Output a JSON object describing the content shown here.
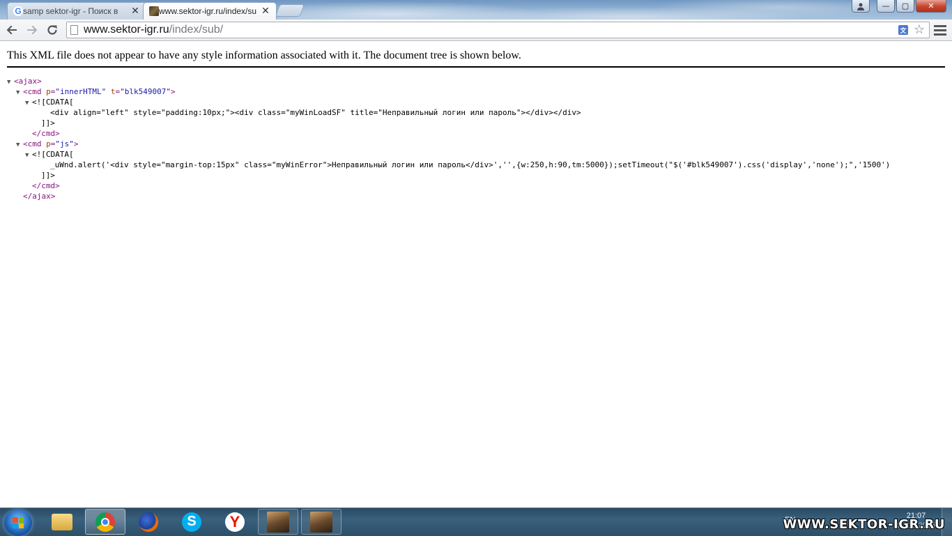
{
  "browser": {
    "tabs": [
      {
        "title": "samp sektor-igr - Поиск в",
        "active": false,
        "icon": "google-icon"
      },
      {
        "title": "www.sektor-igr.ru/index/su",
        "active": true,
        "icon": "site-favicon"
      }
    ],
    "tab_close_glyph": "✕",
    "window_buttons": {
      "minimize": "—",
      "maximize": "▢",
      "close": "✕"
    },
    "address": {
      "host": "www.sektor-igr.ru",
      "path": "/index/sub/"
    }
  },
  "page": {
    "xml_notice": "This XML file does not appear to have any style information associated with it. The document tree is shown below.",
    "tree_lines": [
      {
        "indent": 0,
        "tri": "▼",
        "segments": [
          {
            "t": "tag",
            "v": "<ajax>"
          }
        ]
      },
      {
        "indent": 1,
        "tri": "▼",
        "segments": [
          {
            "t": "tag",
            "v": "<cmd "
          },
          {
            "t": "attr",
            "v": "p"
          },
          {
            "t": "tag",
            "v": "="
          },
          {
            "t": "val",
            "v": "\"innerHTML\""
          },
          {
            "t": "tag",
            "v": " "
          },
          {
            "t": "attr",
            "v": "t"
          },
          {
            "t": "tag",
            "v": "="
          },
          {
            "t": "val",
            "v": "\"blk549007\""
          },
          {
            "t": "tag",
            "v": ">"
          }
        ]
      },
      {
        "indent": 2,
        "tri": "▼",
        "segments": [
          {
            "t": "plain",
            "v": "<![CDATA["
          }
        ]
      },
      {
        "indent": 4,
        "tri": "",
        "segments": [
          {
            "t": "plain",
            "v": "<div align=\"left\" style=\"padding:10px;\"><div class=\"myWinLoadSF\" title=\"Неправильный логин или пароль\"></div></div>"
          }
        ]
      },
      {
        "indent": 3,
        "tri": "",
        "segments": [
          {
            "t": "plain",
            "v": "]]>"
          }
        ]
      },
      {
        "indent": 2,
        "tri": "",
        "segments": [
          {
            "t": "tag",
            "v": "</cmd>"
          }
        ]
      },
      {
        "indent": 1,
        "tri": "▼",
        "segments": [
          {
            "t": "tag",
            "v": "<cmd "
          },
          {
            "t": "attr",
            "v": "p"
          },
          {
            "t": "tag",
            "v": "="
          },
          {
            "t": "val",
            "v": "\"js\""
          },
          {
            "t": "tag",
            "v": ">"
          }
        ]
      },
      {
        "indent": 2,
        "tri": "▼",
        "segments": [
          {
            "t": "plain",
            "v": "<![CDATA["
          }
        ]
      },
      {
        "indent": 4,
        "tri": "",
        "segments": [
          {
            "t": "plain",
            "v": "_uWnd.alert('<div style=\"margin-top:15px\" class=\"myWinError\">Неправильный логин или пароль</div>','',{w:250,h:90,tm:5000});setTimeout(\"$('#blk549007').css('display','none');\",'1500')"
          }
        ]
      },
      {
        "indent": 3,
        "tri": "",
        "segments": [
          {
            "t": "plain",
            "v": "]]>"
          }
        ]
      },
      {
        "indent": 2,
        "tri": "",
        "segments": [
          {
            "t": "tag",
            "v": "</cmd>"
          }
        ]
      },
      {
        "indent": 1,
        "tri": "",
        "segments": [
          {
            "t": "tag",
            "v": "</ajax>"
          }
        ]
      }
    ]
  },
  "taskbar": {
    "items": [
      {
        "name": "explorer-icon",
        "active": false
      },
      {
        "name": "chrome-icon",
        "active": true
      },
      {
        "name": "firefox-icon",
        "active": false
      },
      {
        "name": "skype-icon",
        "active": false,
        "glyph": "S"
      },
      {
        "name": "yandex-browser-icon",
        "active": false,
        "glyph": "Y"
      },
      {
        "name": "game-app-icon",
        "active": false,
        "framed": true
      },
      {
        "name": "game-app-icon",
        "active": false,
        "framed": true
      }
    ],
    "language": "EN",
    "time": "21:07",
    "date": "07.12.2015",
    "watermark": "WWW.SEKTOR-IGR.RU"
  }
}
